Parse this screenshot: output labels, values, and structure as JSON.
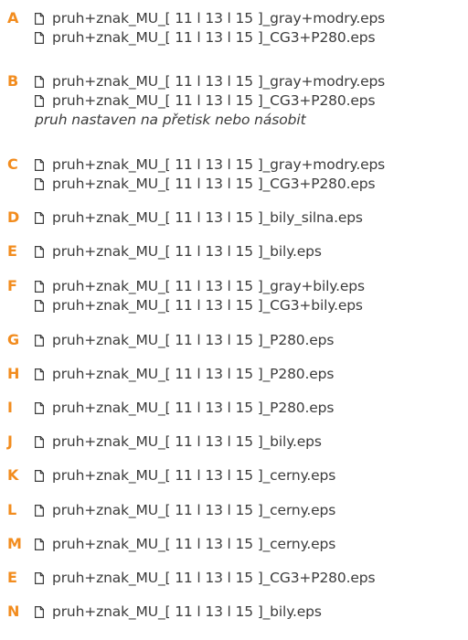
{
  "colors": {
    "accent": "#f28c1e",
    "text": "#3c3c3c"
  },
  "icon": "file-icon",
  "entries": [
    {
      "letter": "A",
      "files": [
        "pruh+znak_MU_[ 11 l 13 l 15 ]_gray+modry.eps",
        "pruh+znak_MU_[ 11 l 13 l 15 ]_CG3+P280.eps"
      ]
    },
    {
      "letter": "B",
      "files": [
        "pruh+znak_MU_[ 11 l 13 l 15 ]_gray+modry.eps",
        "pruh+znak_MU_[ 11 l 13 l 15 ]_CG3+P280.eps"
      ],
      "note": "pruh nastaven na přetisk nebo násobit"
    },
    {
      "letter": "C",
      "files": [
        "pruh+znak_MU_[ 11 l 13 l 15 ]_gray+modry.eps",
        "pruh+znak_MU_[ 11 l 13 l 15 ]_CG3+P280.eps"
      ]
    },
    {
      "letter": "D",
      "files": [
        "pruh+znak_MU_[ 11 l 13 l 15 ]_bily_silna.eps"
      ]
    },
    {
      "letter": "E",
      "files": [
        "pruh+znak_MU_[ 11 l 13 l 15 ]_bily.eps"
      ]
    },
    {
      "letter": "F",
      "files": [
        "pruh+znak_MU_[ 11 l 13 l 15 ]_gray+bily.eps",
        "pruh+znak_MU_[ 11 l 13 l 15 ]_CG3+bily.eps"
      ]
    },
    {
      "letter": "G",
      "files": [
        "pruh+znak_MU_[ 11 l 13 l 15 ]_P280.eps"
      ]
    },
    {
      "letter": "H",
      "files": [
        "pruh+znak_MU_[ 11 l 13 l 15 ]_P280.eps"
      ]
    },
    {
      "letter": "I",
      "files": [
        "pruh+znak_MU_[ 11 l 13 l 15 ]_P280.eps"
      ]
    },
    {
      "letter": "J",
      "files": [
        "pruh+znak_MU_[ 11 l 13 l 15 ]_bily.eps"
      ]
    },
    {
      "letter": "K",
      "files": [
        "pruh+znak_MU_[ 11 l 13 l 15 ]_cerny.eps"
      ]
    },
    {
      "letter": "L",
      "files": [
        "pruh+znak_MU_[ 11 l 13 l 15 ]_cerny.eps"
      ]
    },
    {
      "letter": "M",
      "files": [
        "pruh+znak_MU_[ 11 l 13 l 15 ]_cerny.eps"
      ]
    },
    {
      "letter": "E",
      "files": [
        "pruh+znak_MU_[ 11 l 13 l 15 ]_CG3+P280.eps"
      ]
    },
    {
      "letter": "N",
      "files": [
        "pruh+znak_MU_[ 11 l 13 l 15 ]_bily.eps"
      ]
    }
  ]
}
